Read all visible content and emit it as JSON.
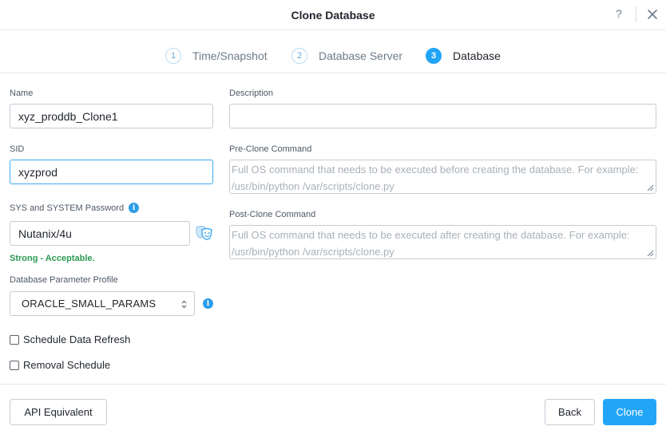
{
  "dialog": {
    "title": "Clone Database",
    "help_label": "?"
  },
  "steps": [
    {
      "number": "1",
      "label": "Time/Snapshot",
      "active": false
    },
    {
      "number": "2",
      "label": "Database Server",
      "active": false
    },
    {
      "number": "3",
      "label": "Database",
      "active": true
    }
  ],
  "form": {
    "name_label": "Name",
    "name_value": "xyz_proddb_Clone1",
    "sid_label": "SID",
    "sid_value": "xyzprod",
    "password_label": "SYS and SYSTEM Password",
    "password_value": "Nutanix/4u",
    "password_strength": "Strong - Acceptable.",
    "param_profile_label": "Database Parameter Profile",
    "param_profile_value": "ORACLE_SMALL_PARAMS",
    "schedule_refresh_label": "Schedule Data Refresh",
    "schedule_refresh_checked": false,
    "removal_schedule_label": "Removal Schedule",
    "removal_schedule_checked": false,
    "description_label": "Description",
    "description_value": "",
    "pre_clone_label": "Pre-Clone Command",
    "pre_clone_placeholder": "Full OS command that needs to be executed before creating the database. For example: /usr/bin/python /var/scripts/clone.py",
    "post_clone_label": "Post-Clone Command",
    "post_clone_placeholder": "Full OS command that needs to be executed after creating the database. For example: /usr/bin/python /var/scripts/clone.py"
  },
  "footer": {
    "api_label": "API Equivalent",
    "back_label": "Back",
    "clone_label": "Clone"
  },
  "colors": {
    "accent": "#22a5f7",
    "success": "#2a9a53",
    "border": "#c5ccd4"
  },
  "icons": {
    "close": "close-icon",
    "info": "info-icon",
    "show_password": "theater-masks-icon",
    "select_arrows": "select-updown-icon"
  }
}
